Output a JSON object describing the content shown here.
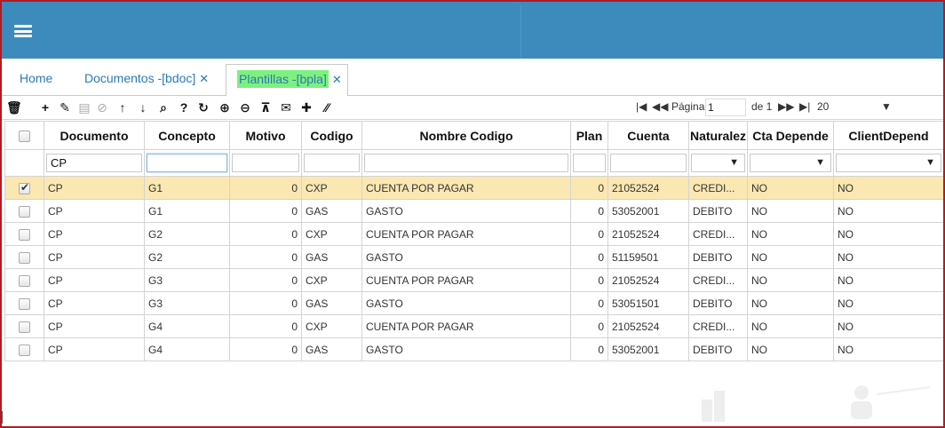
{
  "tabs": [
    {
      "label": "Home",
      "closable": false,
      "active": false
    },
    {
      "label": "Documentos -[bdoc]",
      "closable": true,
      "active": false
    },
    {
      "label": "Plantillas -[bpla]",
      "closable": true,
      "active": true
    }
  ],
  "toolbar": {
    "icons": [
      "delete-icon",
      "add-icon",
      "edit-icon",
      "save-icon",
      "cancel-icon",
      "move-up-icon",
      "move-down-icon",
      "search-icon",
      "help-icon",
      "refresh-icon",
      "zoom-in-icon",
      "zoom-out-icon",
      "pin-icon",
      "email-icon",
      "plus-circle-icon",
      "resize-icon"
    ],
    "glyphs": [
      "🗑",
      "+",
      "✎",
      "▤",
      "⊘",
      "↑",
      "↓",
      "⌕",
      "?",
      "↻",
      "⊕",
      "⊖",
      "⊼",
      "✉",
      "✚",
      "⁄⁄"
    ]
  },
  "pager": {
    "first": "|◀",
    "prev": "◀◀",
    "page_label": "Página",
    "page_value": "1",
    "of_label": "de 1",
    "next": "▶▶",
    "last": "▶|",
    "page_size": "20"
  },
  "grid": {
    "columns": [
      "Documento",
      "Concepto",
      "Motivo",
      "Codigo",
      "Nombre Codigo",
      "Plan",
      "Cuenta",
      "Naturalez",
      "Cta Depende",
      "ClientDepend"
    ],
    "filters": {
      "documento": "CP"
    },
    "rows": [
      {
        "checked": true,
        "documento": "CP",
        "concepto": "G1",
        "motivo": "0",
        "codigo": "CXP",
        "nombre": "CUENTA POR PAGAR",
        "plan": "0",
        "cuenta": "21052524",
        "naturaleza": "CREDI...",
        "cta_depende": "NO",
        "client_depend": "NO"
      },
      {
        "checked": false,
        "documento": "CP",
        "concepto": "G1",
        "motivo": "0",
        "codigo": "GAS",
        "nombre": "GASTO",
        "plan": "0",
        "cuenta": "53052001",
        "naturaleza": "DEBITO",
        "cta_depende": "NO",
        "client_depend": "NO"
      },
      {
        "checked": false,
        "documento": "CP",
        "concepto": "G2",
        "motivo": "0",
        "codigo": "CXP",
        "nombre": "CUENTA POR PAGAR",
        "plan": "0",
        "cuenta": "21052524",
        "naturaleza": "CREDI...",
        "cta_depende": "NO",
        "client_depend": "NO"
      },
      {
        "checked": false,
        "documento": "CP",
        "concepto": "G2",
        "motivo": "0",
        "codigo": "GAS",
        "nombre": "GASTO",
        "plan": "0",
        "cuenta": "51159501",
        "naturaleza": "DEBITO",
        "cta_depende": "NO",
        "client_depend": "NO"
      },
      {
        "checked": false,
        "documento": "CP",
        "concepto": "G3",
        "motivo": "0",
        "codigo": "CXP",
        "nombre": "CUENTA POR PAGAR",
        "plan": "0",
        "cuenta": "21052524",
        "naturaleza": "CREDI...",
        "cta_depende": "NO",
        "client_depend": "NO"
      },
      {
        "checked": false,
        "documento": "CP",
        "concepto": "G3",
        "motivo": "0",
        "codigo": "GAS",
        "nombre": "GASTO",
        "plan": "0",
        "cuenta": "53051501",
        "naturaleza": "DEBITO",
        "cta_depende": "NO",
        "client_depend": "NO"
      },
      {
        "checked": false,
        "documento": "CP",
        "concepto": "G4",
        "motivo": "0",
        "codigo": "CXP",
        "nombre": "CUENTA POR PAGAR",
        "plan": "0",
        "cuenta": "21052524",
        "naturaleza": "CREDI...",
        "cta_depende": "NO",
        "client_depend": "NO"
      },
      {
        "checked": false,
        "documento": "CP",
        "concepto": "G4",
        "motivo": "0",
        "codigo": "GAS",
        "nombre": "GASTO",
        "plan": "0",
        "cuenta": "53052001",
        "naturaleza": "DEBITO",
        "cta_depende": "NO",
        "client_depend": "NO"
      }
    ]
  },
  "colors": {
    "header_blue": "#3d8bbd",
    "frame_red": "#b01c22",
    "tab_link": "#2a7ab8",
    "active_tab_highlight": "#7ef07f",
    "selected_row": "#fbe7b1"
  }
}
